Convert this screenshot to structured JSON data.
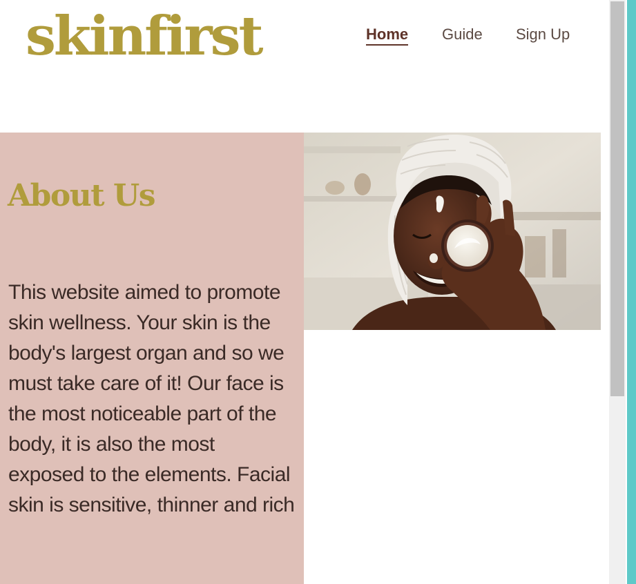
{
  "site": {
    "logo_text": "skinfirst"
  },
  "nav": {
    "items": [
      {
        "label": "Home",
        "active": true
      },
      {
        "label": "Guide",
        "active": false
      },
      {
        "label": "Sign Up",
        "active": false
      }
    ]
  },
  "about": {
    "heading": "About Us",
    "body": "This website aimed to promote skin wellness. Your skin is the body's largest organ and so we must take care of it! Our face is the most noticeable part of the body, it is also the most exposed to the elements. Facial skin is sensitive, thinner and rich"
  },
  "colors": {
    "logo": "#b09c3c",
    "heading": "#b09c3c",
    "nav_active": "#5e3329",
    "nav_inactive": "#5b4a43",
    "panel_bg": "#dfc0b8",
    "body_text": "#3a2a26",
    "scroll_track": "#f0f0f0",
    "scroll_thumb": "#c1c1c1",
    "edge_strip": "#5ec9c8"
  },
  "icons": {
    "hero_image": "woman-with-towel-holding-cream-jar-image"
  }
}
